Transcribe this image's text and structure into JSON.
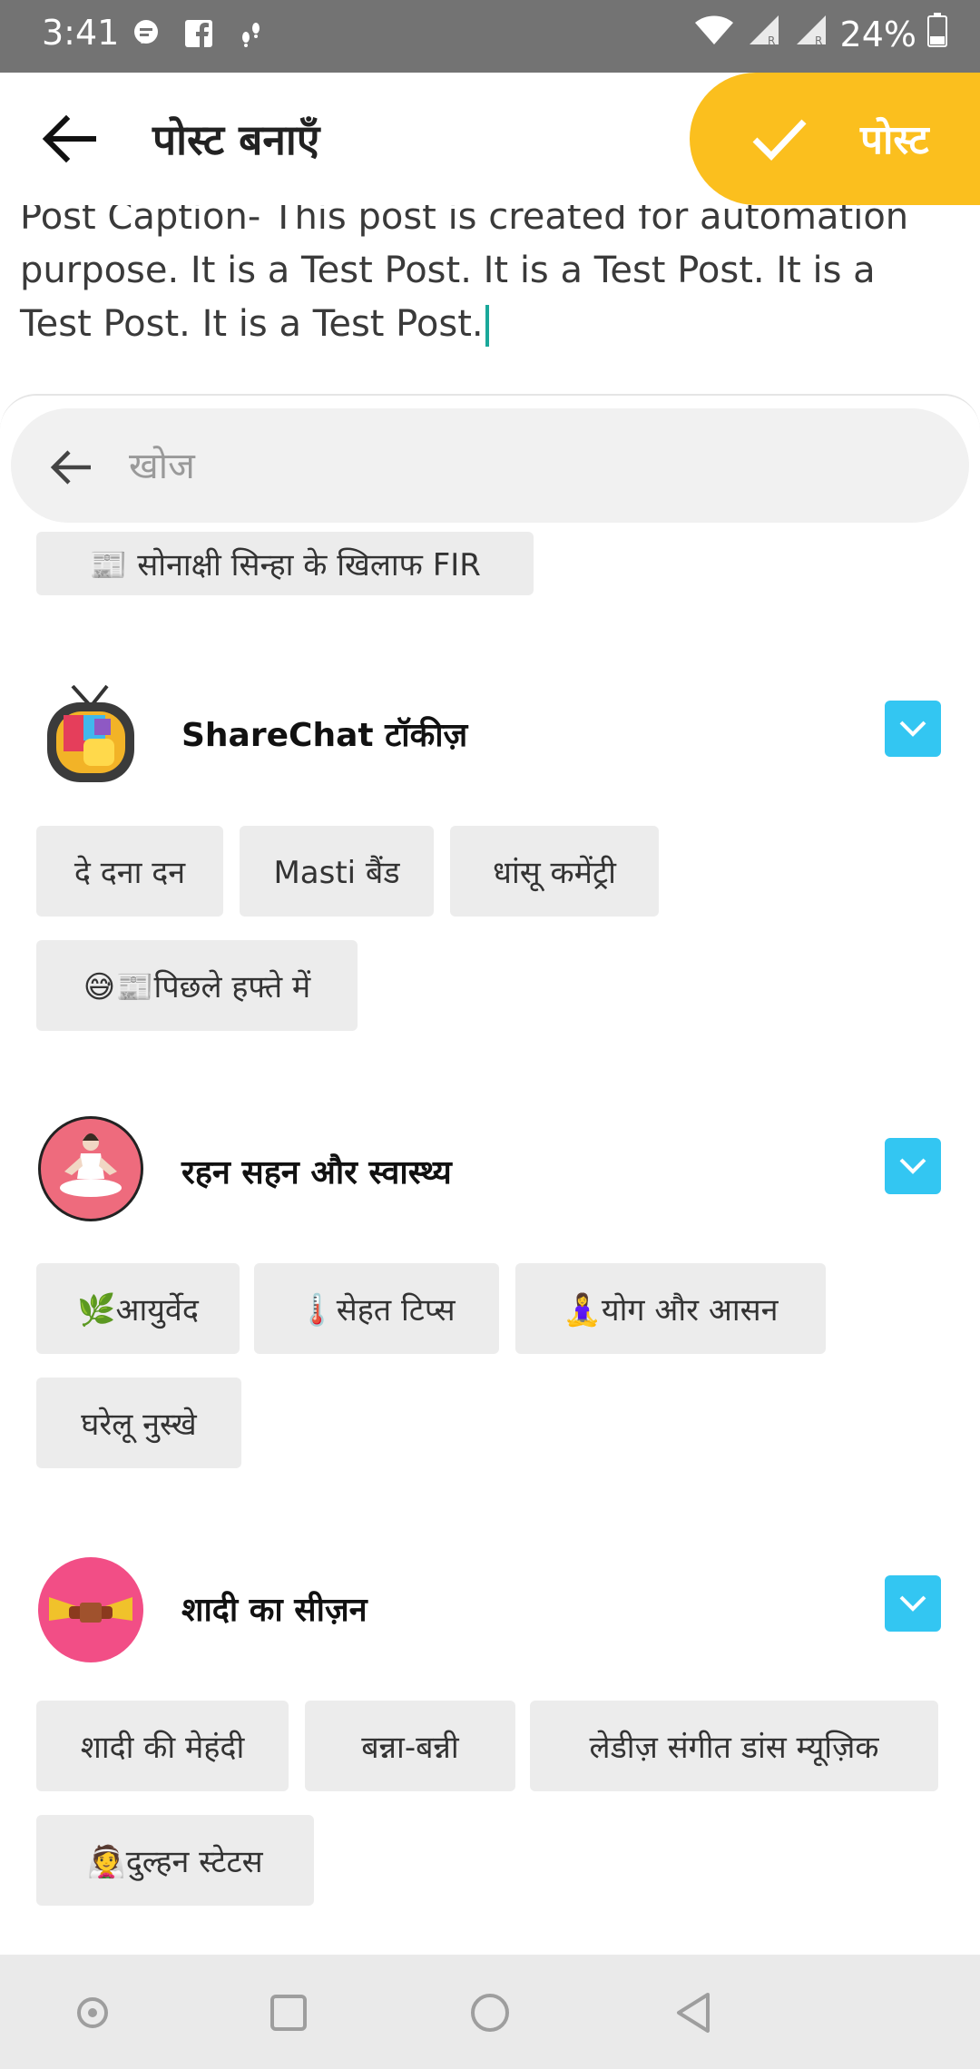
{
  "status_bar": {
    "time": "3:41",
    "battery": "24%"
  },
  "app_bar": {
    "title": "पोस्ट बनाएँ",
    "post_label": "पोस्ट",
    "accent_color": "#fbbf1e"
  },
  "caption": {
    "text": "Post Caption- This post is created for automation purpose. It is a Test Post. It is a Test Post. It is a Test Post. It is a Test Post."
  },
  "search": {
    "placeholder": "खोज",
    "value": ""
  },
  "partial_chip": "📰 सोनाक्षी सिन्हा के खिलाफ FIR",
  "categories": [
    {
      "title": "ShareChat टॉकीज़",
      "icon": "tv-icon",
      "chips": [
        "दे दना दन",
        "Masti बैंड",
        "धांसू कमेंट्री",
        "😅📰पिछले हफ्ते में"
      ]
    },
    {
      "title": "रहन सहन और स्वास्थ्य",
      "icon": "yoga-icon",
      "chips": [
        "🌿आयुर्वेद",
        "🌡️सेहत टिप्स",
        "🧘‍♀️योग और आसन",
        "घरेलू नुस्खे"
      ]
    },
    {
      "title": "शादी का सीज़न",
      "icon": "wedding-icon",
      "chips": [
        "शादी की मेहंदी",
        "बन्ना-बन्नी",
        "लेडीज़ संगीत डांस म्यूज़िक",
        "👰दुल्हन स्टेटस"
      ]
    }
  ],
  "toggle_color": "#33c6f2"
}
